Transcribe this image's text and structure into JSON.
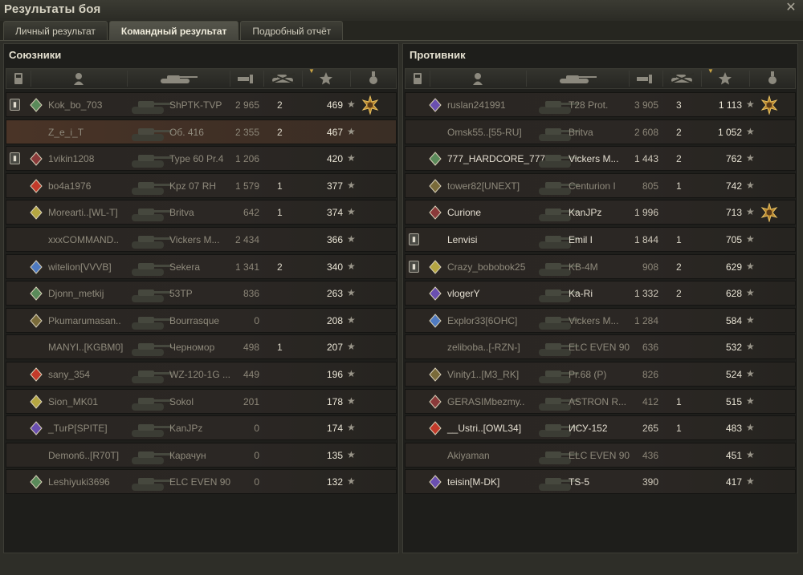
{
  "window": {
    "title": "Результаты боя",
    "close_icon": "close-icon"
  },
  "tabs": [
    {
      "label": "Личный результат",
      "active": false
    },
    {
      "label": "Командный результат",
      "active": true
    },
    {
      "label": "Подробный отчёт",
      "active": false
    }
  ],
  "header_icons": [
    "platoon-icon",
    "player-icon",
    "tank-icon",
    "damage-icon",
    "kills-icon",
    "xp-icon",
    "medal-icon"
  ],
  "colors": {
    "accent": "#c9a444",
    "my_row": "#4a3427",
    "row": "#2a2622"
  },
  "allies": {
    "title": "Союзники",
    "rows": [
      {
        "platoon": true,
        "nick": "Kok_bo_703",
        "tank": "ShPTK-TVP",
        "damage": "2 965",
        "kills": "2",
        "xp": "469",
        "medal": true,
        "me": false,
        "alive": false
      },
      {
        "platoon": false,
        "nick": "Z_e_i_T",
        "tank": "Об. 416",
        "damage": "2 355",
        "kills": "2",
        "xp": "467",
        "medal": false,
        "me": true,
        "alive": false
      },
      {
        "platoon": true,
        "nick": "1vikin1208",
        "tank": "Type 60 Pr.4",
        "damage": "1 206",
        "kills": "",
        "xp": "420",
        "medal": false,
        "me": false,
        "alive": false
      },
      {
        "platoon": false,
        "nick": "bo4a1976",
        "tank": "Kpz 07 RH",
        "damage": "1 579",
        "kills": "1",
        "xp": "377",
        "medal": false,
        "me": false,
        "alive": false
      },
      {
        "platoon": false,
        "nick": "Morearti..[WL-T]",
        "tank": "Britva",
        "damage": "642",
        "kills": "1",
        "xp": "374",
        "medal": false,
        "me": false,
        "alive": false
      },
      {
        "platoon": false,
        "nick": "xxxCOMMAND..",
        "tank": "Vickers M...",
        "damage": "2 434",
        "kills": "",
        "xp": "366",
        "medal": false,
        "me": false,
        "alive": false
      },
      {
        "platoon": false,
        "nick": "witelion[VVVB]",
        "tank": "Sekera",
        "damage": "1 341",
        "kills": "2",
        "xp": "340",
        "medal": false,
        "me": false,
        "alive": false
      },
      {
        "platoon": false,
        "nick": "Djonn_metkij",
        "tank": "53TP",
        "damage": "836",
        "kills": "",
        "xp": "263",
        "medal": false,
        "me": false,
        "alive": false
      },
      {
        "platoon": false,
        "nick": "Pkumarumasan..",
        "tank": "Bourrasque",
        "damage": "0",
        "kills": "",
        "xp": "208",
        "medal": false,
        "me": false,
        "alive": false
      },
      {
        "platoon": false,
        "nick": "MANYI..[KGBM0]",
        "tank": "Черномор",
        "damage": "498",
        "kills": "1",
        "xp": "207",
        "medal": false,
        "me": false,
        "alive": false
      },
      {
        "platoon": false,
        "nick": "sany_354",
        "tank": "WZ-120-1G ...",
        "damage": "449",
        "kills": "",
        "xp": "196",
        "medal": false,
        "me": false,
        "alive": false
      },
      {
        "platoon": false,
        "nick": "Sion_MK01",
        "tank": "Sokol",
        "damage": "201",
        "kills": "",
        "xp": "178",
        "medal": false,
        "me": false,
        "alive": false
      },
      {
        "platoon": false,
        "nick": "_TurP[SPITE]",
        "tank": "KanJPz",
        "damage": "0",
        "kills": "",
        "xp": "174",
        "medal": false,
        "me": false,
        "alive": false
      },
      {
        "platoon": false,
        "nick": "Demon6..[R70T]",
        "tank": "Карачун",
        "damage": "0",
        "kills": "",
        "xp": "135",
        "medal": false,
        "me": false,
        "alive": false
      },
      {
        "platoon": false,
        "nick": "Leshiyuki3696",
        "tank": "ELC EVEN 90",
        "damage": "0",
        "kills": "",
        "xp": "132",
        "medal": false,
        "me": false,
        "alive": false
      }
    ]
  },
  "enemies": {
    "title": "Противник",
    "rows": [
      {
        "platoon": false,
        "nick": "ruslan241991",
        "tank": "T28 Prot.",
        "damage": "3 905",
        "kills": "3",
        "xp": "1 113",
        "medal": true,
        "me": false,
        "alive": false
      },
      {
        "platoon": false,
        "nick": "Omsk55..[55-RU]",
        "tank": "Britva",
        "damage": "2 608",
        "kills": "2",
        "xp": "1 052",
        "medal": false,
        "me": false,
        "alive": false
      },
      {
        "platoon": false,
        "nick": "777_HARDCORE_777",
        "tank": "Vickers M...",
        "damage": "1 443",
        "kills": "2",
        "xp": "762",
        "medal": false,
        "me": false,
        "alive": true
      },
      {
        "platoon": false,
        "nick": "tower82[UNEXT]",
        "tank": "Centurion I",
        "damage": "805",
        "kills": "1",
        "xp": "742",
        "medal": false,
        "me": false,
        "alive": false
      },
      {
        "platoon": false,
        "nick": "Curione",
        "tank": "KanJPz",
        "damage": "1 996",
        "kills": "",
        "xp": "713",
        "medal": true,
        "me": false,
        "alive": true
      },
      {
        "platoon": true,
        "nick": "Lenvisi",
        "tank": "Emil I",
        "damage": "1 844",
        "kills": "1",
        "xp": "705",
        "medal": false,
        "me": false,
        "alive": true
      },
      {
        "platoon": true,
        "nick": "Crazy_bobobok25",
        "tank": "KB-4M",
        "damage": "908",
        "kills": "2",
        "xp": "629",
        "medal": false,
        "me": false,
        "alive": false
      },
      {
        "platoon": false,
        "nick": "vlogerY",
        "tank": "Ka-Ri",
        "damage": "1 332",
        "kills": "2",
        "xp": "628",
        "medal": false,
        "me": false,
        "alive": true
      },
      {
        "platoon": false,
        "nick": "Explor33[6OHC]",
        "tank": "Vickers M...",
        "damage": "1 284",
        "kills": "",
        "xp": "584",
        "medal": false,
        "me": false,
        "alive": false
      },
      {
        "platoon": false,
        "nick": "zeliboba..[-RZN-]",
        "tank": "ELC EVEN 90",
        "damage": "636",
        "kills": "",
        "xp": "532",
        "medal": false,
        "me": false,
        "alive": false
      },
      {
        "platoon": false,
        "nick": "Vinity1..[M3_RK]",
        "tank": "Pr.68 (P)",
        "damage": "826",
        "kills": "",
        "xp": "524",
        "medal": false,
        "me": false,
        "alive": false
      },
      {
        "platoon": false,
        "nick": "GERASIMbezmy..",
        "tank": "ASTRON R...",
        "damage": "412",
        "kills": "1",
        "xp": "515",
        "medal": false,
        "me": false,
        "alive": false
      },
      {
        "platoon": false,
        "nick": "__Ustri..[OWL34]",
        "tank": "ИСУ-152",
        "damage": "265",
        "kills": "1",
        "xp": "483",
        "medal": false,
        "me": false,
        "alive": true
      },
      {
        "platoon": false,
        "nick": "Akiyaman",
        "tank": "ELC EVEN 90",
        "damage": "436",
        "kills": "",
        "xp": "451",
        "medal": false,
        "me": false,
        "alive": false
      },
      {
        "platoon": false,
        "nick": "teisin[M-DK]",
        "tank": "TS-5",
        "damage": "390",
        "kills": "",
        "xp": "417",
        "medal": false,
        "me": false,
        "alive": true
      }
    ]
  }
}
